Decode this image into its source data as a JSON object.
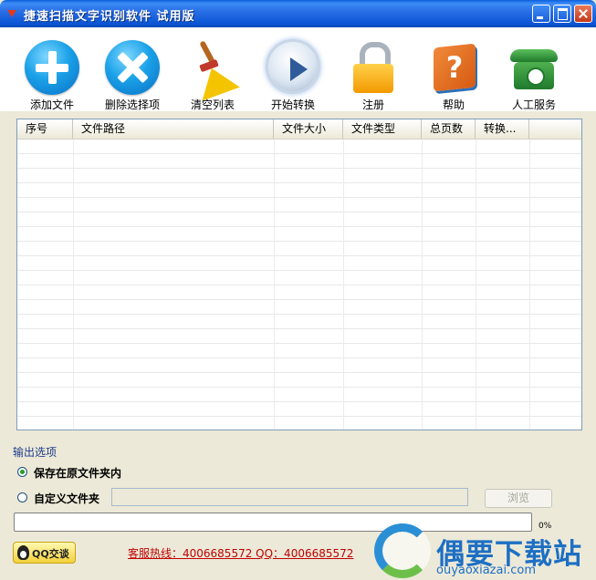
{
  "window": {
    "title": "捷速扫描文字识别软件  试用版"
  },
  "toolbar": {
    "items": [
      {
        "label": "添加文件",
        "icon": "add-file-icon"
      },
      {
        "label": "删除选择项",
        "icon": "delete-selected-icon"
      },
      {
        "label": "清空列表",
        "icon": "broom-icon"
      },
      {
        "label": "开始转换",
        "icon": "play-icon"
      },
      {
        "label": "注册",
        "icon": "lock-icon"
      },
      {
        "label": "帮助",
        "icon": "help-book-icon"
      },
      {
        "label": "人工服务",
        "icon": "phone-icon"
      }
    ]
  },
  "file_list": {
    "columns": [
      "序号",
      "文件路径",
      "文件大小",
      "文件类型",
      "总页数",
      "转换..."
    ],
    "rows": []
  },
  "output": {
    "title": "输出选项",
    "option_original": "保存在原文件夹内",
    "option_custom": "自定义文件夹",
    "custom_path": "",
    "browse_label": "浏览",
    "selected": "original"
  },
  "progress": {
    "value": 0,
    "label": "0%"
  },
  "footer": {
    "qq_label": "QQ交谈",
    "hotline": "客服热线：4006685572 QQ：4006685572"
  },
  "watermark": {
    "title": "偶要下载站",
    "url": "ouyaoxiazai.com"
  },
  "colors": {
    "titlebar": "#0c56d6",
    "hotline": "#c00000",
    "progress": "#2bd12b",
    "watermark": "#1d6fc3"
  }
}
